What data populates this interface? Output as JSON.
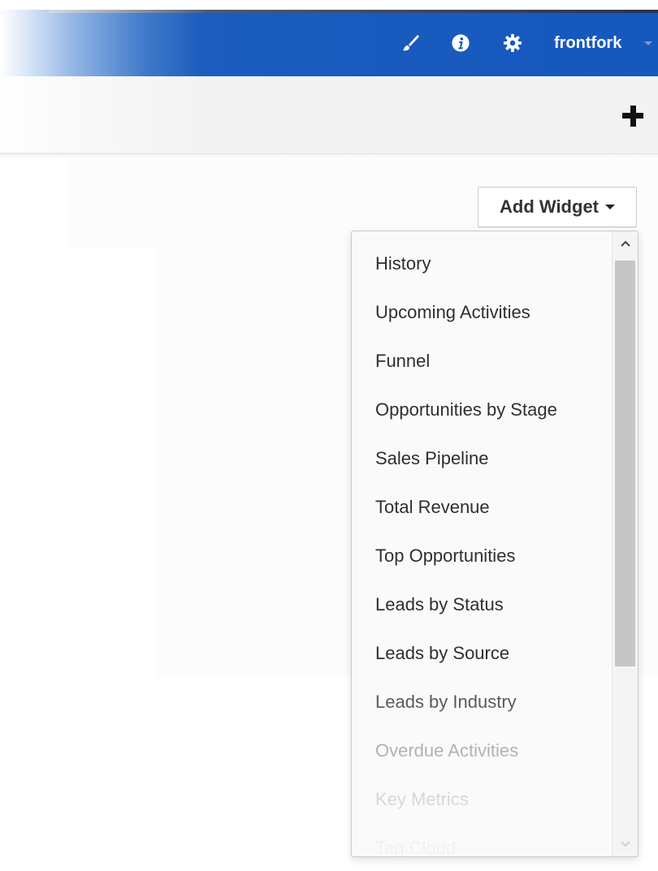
{
  "header": {
    "icons": [
      "paintbrush-icon",
      "info-icon",
      "gear-icon"
    ],
    "username": "frontfork",
    "colors": {
      "bar": "#1558be",
      "text": "#ffffff"
    }
  },
  "toolbar": {
    "add_icon": "plus-icon"
  },
  "add_widget": {
    "label": "Add Widget",
    "caret_icon": "caret-down-icon"
  },
  "dropdown": {
    "items": [
      "History",
      "Upcoming Activities",
      "Funnel",
      "Opportunities by Stage",
      "Sales Pipeline",
      "Total Revenue",
      "Top Opportunities",
      "Leads by Status",
      "Leads by Source",
      "Leads by Industry",
      "Overdue Activities",
      "Key Metrics",
      "Tag Cloud"
    ],
    "scrollbar": {
      "up_icon": "chevron-up-icon",
      "down_icon": "chevron-down-icon",
      "position": 0
    }
  }
}
